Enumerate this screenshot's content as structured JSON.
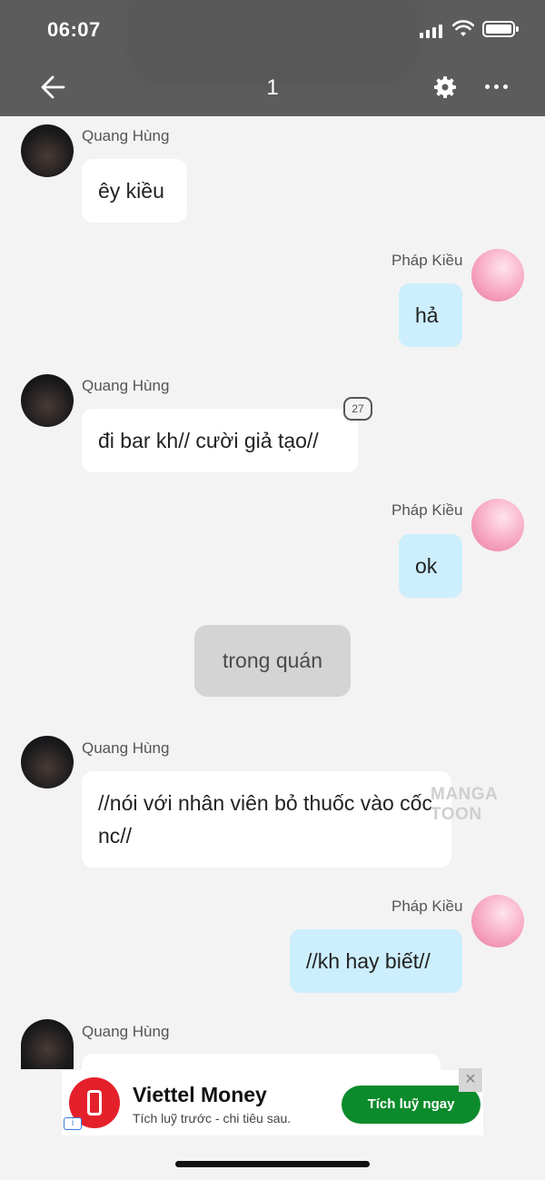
{
  "status_bar": {
    "time": "06:07"
  },
  "header": {
    "title": "1",
    "back_icon": "arrow-left-icon",
    "settings_icon": "gear-icon",
    "more_icon": "more-horizontal-icon",
    "background": "#5c5c5c"
  },
  "messages": [
    {
      "sender": "Quang Hùng",
      "side": "left",
      "text": "êy kiều"
    },
    {
      "sender": "Pháp Kiều",
      "side": "right",
      "text": "hả"
    },
    {
      "sender": "Quang Hùng",
      "side": "left",
      "text": "đi bar kh// cười giả tạo//",
      "comment_count": "27"
    },
    {
      "sender": "Pháp Kiều",
      "side": "right",
      "text": "ok"
    },
    {
      "side": "center",
      "text": "trong quán"
    },
    {
      "sender": "Quang Hùng",
      "side": "left",
      "text": "//nói với nhân viên bỏ thuốc vào cốc nc//"
    },
    {
      "sender": "Pháp Kiều",
      "side": "right",
      "text": "//kh hay biết//"
    },
    {
      "sender": "Quang Hùng",
      "side": "left",
      "text": ""
    }
  ],
  "watermark": "MANGA TOON",
  "ad": {
    "brand": "Viettel Money",
    "tagline": "Tích luỹ trước - chi tiêu sau.",
    "cta": "Tích luỹ ngay",
    "close": "✕",
    "info": "i",
    "brand_color": "#e4212b",
    "cta_color": "#0c8b2c"
  },
  "colors": {
    "left_bubble": "#ffffff",
    "right_bubble": "#cceefd",
    "center_bubble": "#d4d4d4"
  }
}
